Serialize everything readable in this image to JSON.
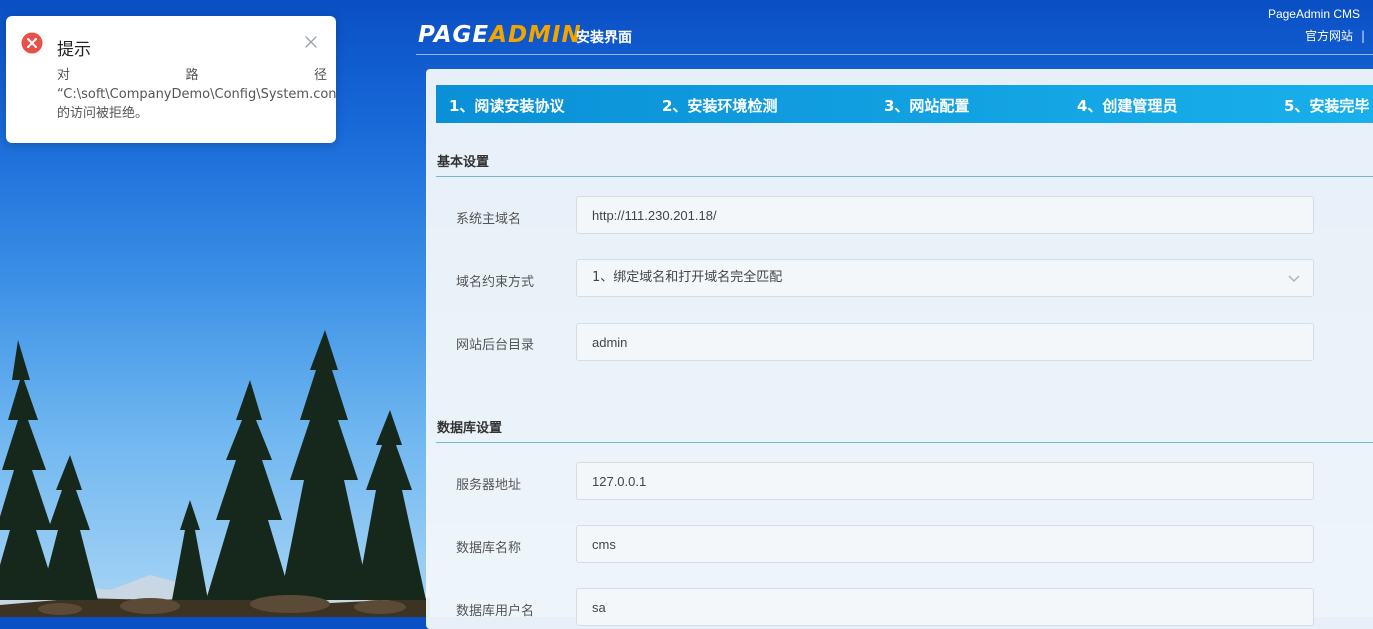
{
  "header": {
    "logo_page": "PAGE",
    "logo_admin": "ADMIN",
    "subtitle": "安装界面",
    "brand": "PageAdmin CMS",
    "official_site": "官方网站",
    "separator": "|"
  },
  "steps": [
    {
      "label": "1、阅读安装协议"
    },
    {
      "label": "2、安装环境检测"
    },
    {
      "label": "3、网站配置"
    },
    {
      "label": "4、创建管理员"
    },
    {
      "label": "5、安装完毕"
    }
  ],
  "basic": {
    "title": "基本设置",
    "domain_label": "系统主域名",
    "domain_value": "http://111.230.201.18/",
    "bind_label": "域名约束方式",
    "bind_value": "1、绑定域名和打开域名完全匹配",
    "admin_dir_label": "网站后台目录",
    "admin_dir_value": "admin"
  },
  "database": {
    "title": "数据库设置",
    "server_label": "服务器地址",
    "server_value": "127.0.0.1",
    "dbname_label": "数据库名称",
    "dbname_value": "cms",
    "user_label": "数据库用户名",
    "user_value": "sa"
  },
  "toast": {
    "title": "提示",
    "msg_chars": [
      "对",
      "路",
      "径"
    ],
    "msg_path": "“C:\\soft\\CompanyDemo\\Config\\System.config”",
    "msg_end": "的访问被拒绝。"
  },
  "colors": {
    "accent": "#0a90d6",
    "logo_admin": "#f2a400",
    "error": "#e8504a"
  },
  "icons": {
    "toast": "error-icon",
    "close": "close-icon",
    "select": "chevron-down-icon"
  }
}
